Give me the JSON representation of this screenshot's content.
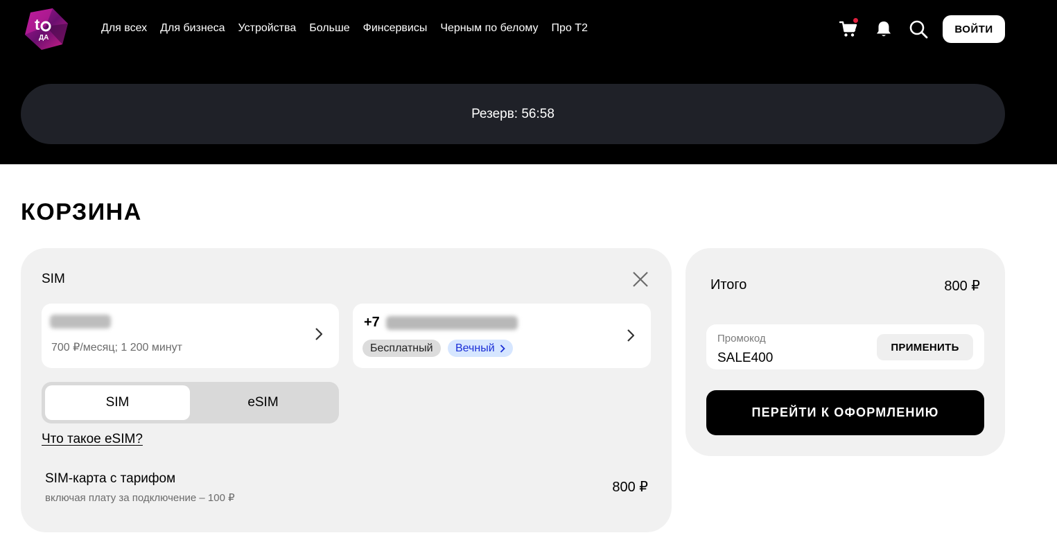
{
  "header": {
    "nav": [
      "Для всех",
      "Для бизнеса",
      "Устройства",
      "Больше",
      "Финсервисы",
      "Черным по белому",
      "Про Т2"
    ],
    "login_label": "ВОЙТИ",
    "cart_has_notification": true
  },
  "reserve": {
    "text": "Резерв: 56:58"
  },
  "page_title": "КОРЗИНА",
  "cart_item": {
    "label": "SIM",
    "tariff_details": "700 ₽/месяц; 1 200 минут",
    "number_prefix": "+7",
    "badge_free": "Бесплатный",
    "badge_eternal": "Вечный",
    "toggle": {
      "sim": "SIM",
      "esim": "eSIM",
      "selected": "SIM"
    },
    "esim_link": "Что такое eSIM?",
    "line_title": "SIM-карта с тарифом",
    "line_sub": "включая плату за подключение – 100 ₽",
    "line_price": "800 ₽"
  },
  "summary": {
    "total_label": "Итого",
    "total_value": "800 ₽",
    "promo_label": "Промокод",
    "promo_value": "SALE400",
    "apply_label": "ПРИМЕНИТЬ",
    "checkout_label": "ПЕРЕЙТИ К ОФОРМЛЕНИЮ"
  },
  "colors": {
    "header_bg": "#000000",
    "reserve_bg": "#1f2128",
    "card_bg": "#f1f1f1",
    "badge_eternal_bg": "#d6e6ff",
    "badge_eternal_text": "#1a2ed6",
    "notification_dot": "#e0203e"
  },
  "icons": [
    "logo-icon",
    "cart-icon",
    "bell-icon",
    "search-icon",
    "close-icon",
    "chevron-right-icon"
  ]
}
